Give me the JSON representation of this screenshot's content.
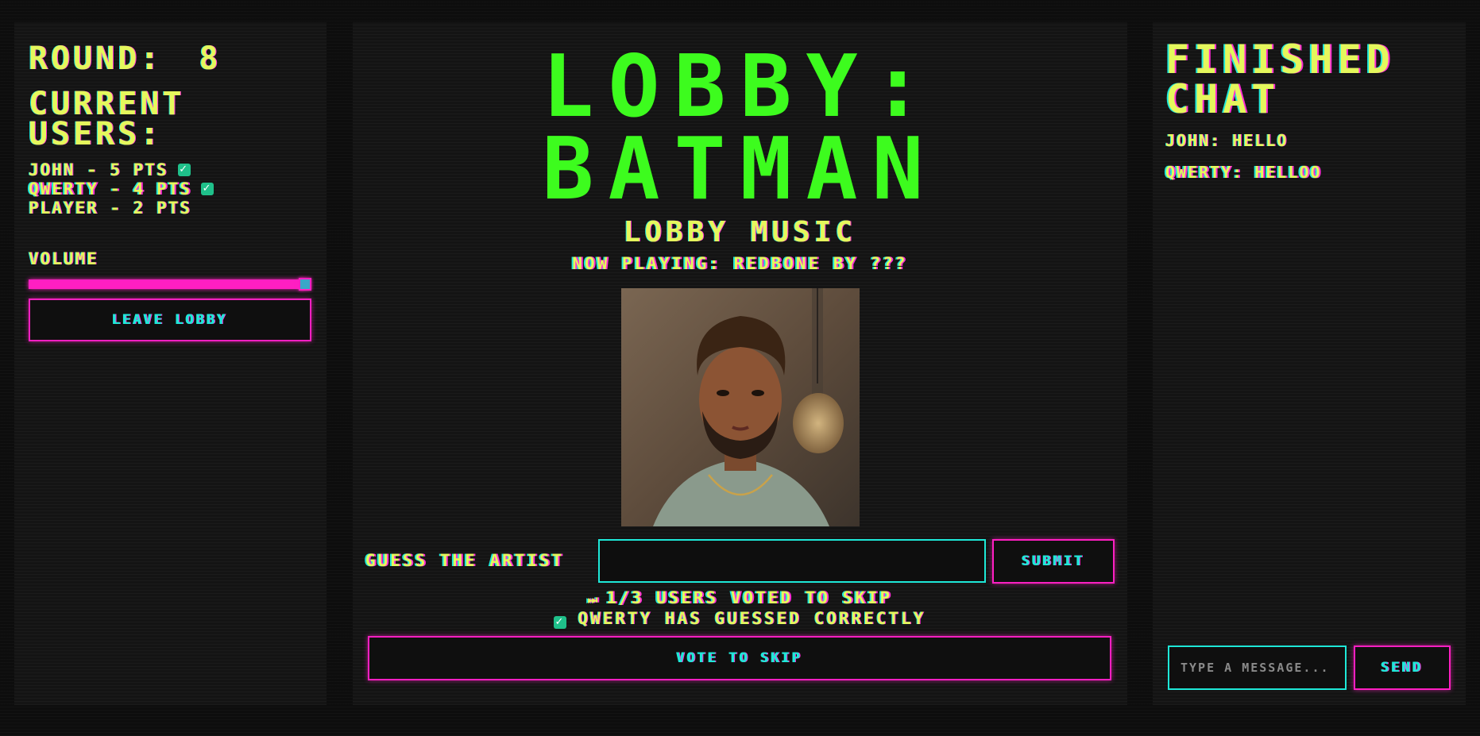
{
  "left": {
    "round_label": "ROUND:",
    "round_value": "8",
    "users_title_line1": "CURRENT",
    "users_title_line2": "USERS:",
    "users": [
      {
        "text": "JOHN - 5 PTS",
        "guessed": true
      },
      {
        "text": "QWERTY - 4 PTS",
        "guessed": true
      },
      {
        "text": "PLAYER - 2 PTS",
        "guessed": false
      }
    ],
    "volume_label": "VOLUME",
    "volume_level_percent": 100,
    "leave_label": "LEAVE LOBBY"
  },
  "center": {
    "lobby_line1": "LOBBY:",
    "lobby_line2": "BATMAN",
    "music_title": "LOBBY MUSIC",
    "now_playing": "NOW PLAYING: REDBONE BY ???",
    "guess_label": "GUESS THE ARTIST",
    "guess_value": "",
    "submit_label": "SUBMIT",
    "skip_icon": "fast-forward-icon",
    "skip_status": "1/3 USERS VOTED TO SKIP",
    "guessed_text": "QWERTY HAS GUESSED CORRECTLY",
    "vote_label": "VOTE TO SKIP"
  },
  "right": {
    "chat_title_line1": "FINISHED",
    "chat_title_line2": "CHAT",
    "messages": [
      {
        "text": "JOHN: HELLO"
      },
      {
        "text": "QWERTY: HELLOO"
      }
    ],
    "message_placeholder": "TYPE A MESSAGE...",
    "send_label": "SEND"
  },
  "colors": {
    "accent_yellow": "#e5f75c",
    "title_green": "#3dfc1e",
    "neon_pink": "#ff1fc2",
    "neon_cyan": "#1ee8d8",
    "check_green": "#1fc08a"
  }
}
